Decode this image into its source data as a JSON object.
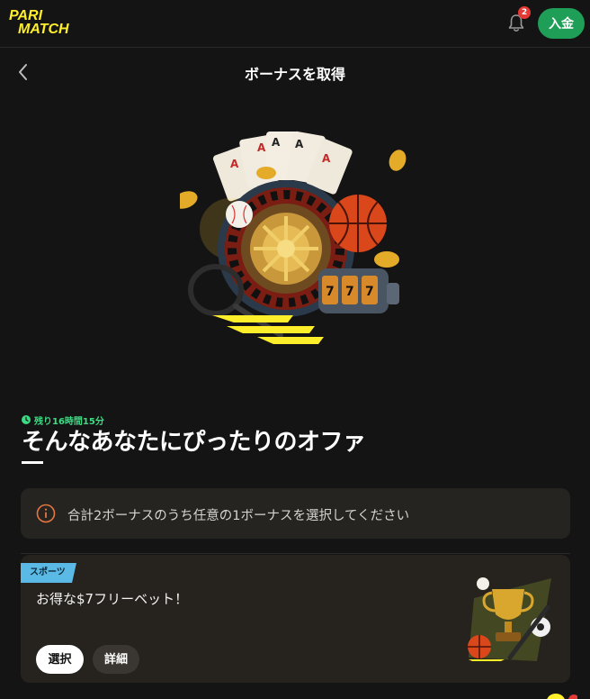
{
  "topbar": {
    "logo_line1": "PARI",
    "logo_line2": "MATCH",
    "notification_count": "2",
    "deposit_label": "入金"
  },
  "header": {
    "title": "ボーナスを取得"
  },
  "offer": {
    "timer_text": "残り16時間15分",
    "headline": "そんなあなたにぴったりのオファ"
  },
  "info": {
    "text": "合計2ボーナスのうち任意の1ボーナスを選択してください"
  },
  "cards": [
    {
      "tag": "スポーツ",
      "title": "お得な$7フリーベット！",
      "select_label": "選択",
      "detail_label": "詳細"
    }
  ],
  "colors": {
    "background": "#141414",
    "brand_yellow": "#ffef2b",
    "deposit_green": "#1f9e57",
    "timer_green": "#3ddc84",
    "tag_blue": "#5bb9e6",
    "info_orange": "#e8763f",
    "badge_red": "#e53935"
  },
  "icons": {
    "notification": "bell-icon",
    "back": "chevron-left-icon",
    "timer": "clock-icon",
    "info": "info-circle-icon"
  }
}
